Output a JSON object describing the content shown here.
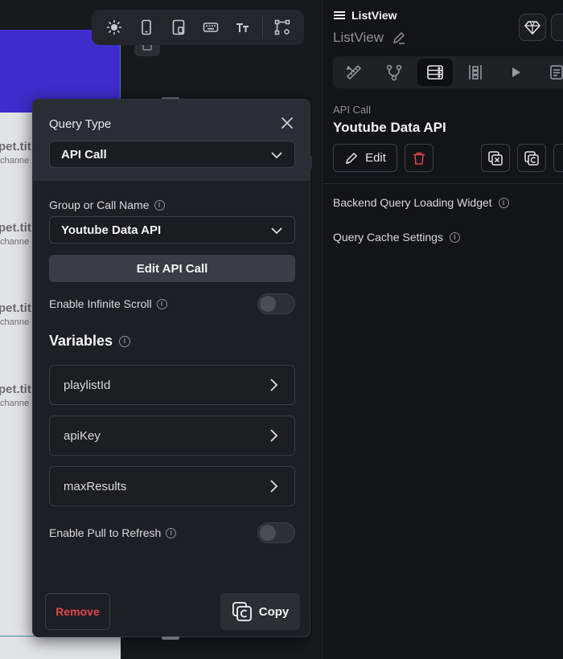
{
  "canvas": {
    "rows": [
      {
        "title": "pet.tit",
        "subtitle": "channe"
      },
      {
        "title": "pet.tit",
        "subtitle": "channe"
      },
      {
        "title": "pet.tit",
        "subtitle": "channe"
      },
      {
        "title": "pet.tit",
        "subtitle": "channe"
      }
    ],
    "toolbar_icons": [
      "sun-icon",
      "phone-icon",
      "tablet-icon",
      "keyboard-icon",
      "text-size-icon",
      "bezier-icon"
    ]
  },
  "popup": {
    "query_type_label": "Query Type",
    "query_type_value": "API Call",
    "group_label": "Group or Call Name",
    "group_value": "Youtube Data API",
    "edit_api_call_label": "Edit API Call",
    "infinite_scroll_label": "Enable Infinite Scroll",
    "infinite_scroll_on": false,
    "variables_heading": "Variables",
    "variables": [
      "playlistId",
      "apiKey",
      "maxResults"
    ],
    "pull_refresh_label": "Enable Pull to Refresh",
    "pull_refresh_on": false,
    "remove_label": "Remove",
    "copy_label": "Copy"
  },
  "panel": {
    "widget_type": "ListView",
    "widget_name": "ListView",
    "api_kind": "API Call",
    "api_name": "Youtube Data API",
    "edit_label": "Edit",
    "loading_widget_label": "Backend Query Loading Widget",
    "cache_settings_label": "Query Cache Settings"
  },
  "colors": {
    "accent_purple": "#3f2ccb",
    "danger": "#e0474c",
    "teal_outline": "#3a8f89"
  }
}
